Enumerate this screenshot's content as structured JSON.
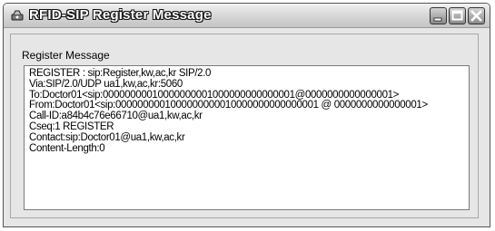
{
  "window": {
    "title": "RFID-SIP Register Message",
    "icons": {
      "app": "app-icon",
      "minimize": "minimize-icon",
      "maximize": "maximize-icon",
      "close": "close-icon"
    }
  },
  "group": {
    "label": "Register Message"
  },
  "message": {
    "lines": [
      "REGISTER : sip:Register,kw,ac,kr SIP/2.0",
      "Via:SIP/2.0/UDP ua1,kw,ac,kr:5060",
      "To:Doctor01<sip:00000000010000000001000000000000001@0000000000000001>",
      "From:Doctor01<sip:0000000001000000000010000000000000001 @ 0000000000000001>",
      "Call-ID:a84b4c76e66710@ua1,kw,ac,kr",
      "Cseq:1 REGISTER",
      "Contact:sip:Doctor01@ua1,kw,ac,kr",
      "Content-Length:0"
    ]
  }
}
